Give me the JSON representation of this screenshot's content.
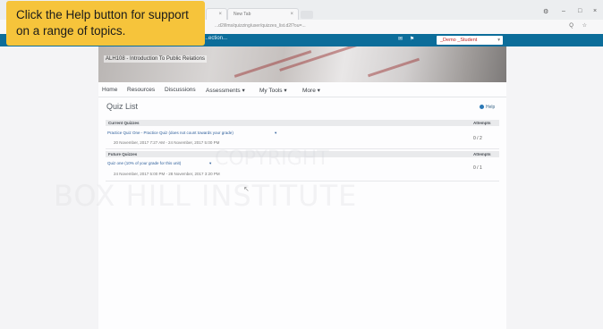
{
  "browser": {
    "tabs": [
      {
        "title": "",
        "close": "×"
      },
      {
        "title": "New Tab",
        "close": "×"
      }
    ],
    "url": "...d2l/lms/quizzing/user/quizzes_list.d2l?ou=...",
    "window_controls": [
      "⚙",
      "–",
      "□",
      "×"
    ],
    "addr_icons": "Q ☆"
  },
  "topnav": {
    "org_selector": "...ection...",
    "user_name": "_Demo _Student",
    "user_caret": "▾",
    "icons": "✉ ⚑"
  },
  "course": {
    "banner_title": "ALH108 - Introduction To Public Relations",
    "nav": [
      "Home",
      "Resources",
      "Discussions",
      "Assessments ▾",
      "My Tools ▾",
      "More ▾"
    ]
  },
  "quiz_list": {
    "title": "Quiz List",
    "help_label": "Help",
    "sections": [
      {
        "header": "Current Quizzes",
        "attempts_header": "Attempts",
        "quizzes": [
          {
            "name": "Practice Quiz One - Practice Quiz (does not count towards your grade)",
            "dates": "20 November, 2017 7:27 AM - 24 November, 2017 5:00 PM",
            "attempts": "0 / 2"
          }
        ]
      },
      {
        "header": "Future Quizzes",
        "attempts_header": "Attempts",
        "quizzes": [
          {
            "name": "Quiz one (10% of your grade for this unit)",
            "dates": "24 November, 2017 5:00 PM - 28 November, 2017 3:20 PM",
            "attempts": "0 / 1"
          }
        ]
      }
    ]
  },
  "watermark": {
    "line1": "COPYRIGHT",
    "line2": "BOX HILL INSTITUTE"
  },
  "callout": {
    "text": "Click the Help button for support on a range of topics."
  }
}
